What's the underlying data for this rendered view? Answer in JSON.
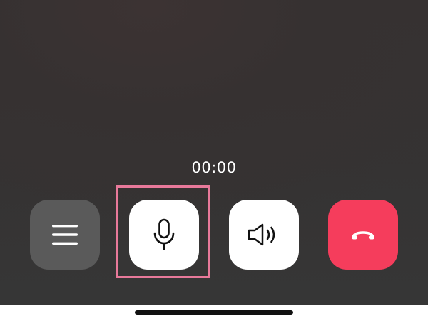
{
  "call": {
    "timer": "00:00"
  },
  "controls": {
    "menu": {
      "icon": "hamburger-menu-icon",
      "color": "#5a5a5a"
    },
    "mic": {
      "icon": "microphone-icon",
      "color": "#ffffff",
      "highlighted": true,
      "highlight_color": "#e8799a"
    },
    "speaker": {
      "icon": "speaker-icon",
      "color": "#ffffff"
    },
    "end_call": {
      "icon": "hang-up-icon",
      "color": "#f53d5c"
    }
  },
  "theme": {
    "background": "#363131",
    "timer_color": "#ffffff"
  }
}
